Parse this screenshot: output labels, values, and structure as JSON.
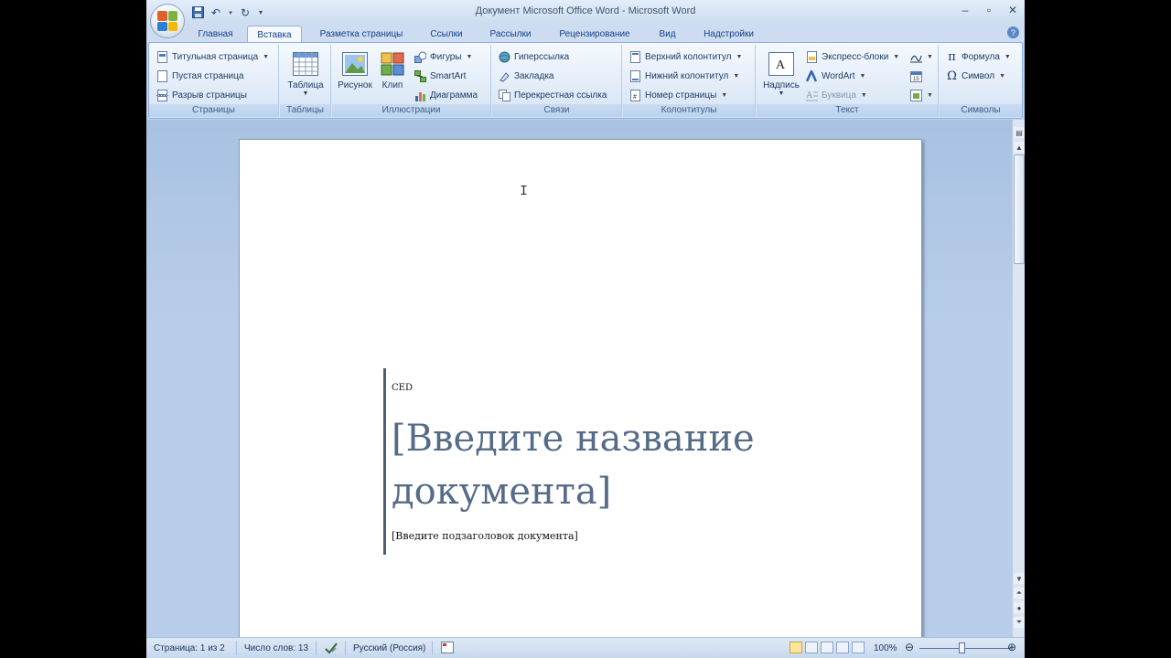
{
  "window": {
    "title": "Документ Microsoft Office Word - Microsoft Word"
  },
  "tabs": [
    {
      "label": "Главная",
      "active": false
    },
    {
      "label": "Вставка",
      "active": true
    },
    {
      "label": "Разметка страницы",
      "active": false
    },
    {
      "label": "Ссылки",
      "active": false
    },
    {
      "label": "Рассылки",
      "active": false
    },
    {
      "label": "Рецензирование",
      "active": false
    },
    {
      "label": "Вид",
      "active": false
    },
    {
      "label": "Надстройки",
      "active": false
    }
  ],
  "ribbon": {
    "pages": {
      "label": "Страницы",
      "items": [
        "Титульная страница",
        "Пустая страница",
        "Разрыв страницы"
      ]
    },
    "tables": {
      "label": "Таблицы",
      "table_button": "Таблица"
    },
    "illustrations": {
      "label": "Иллюстрации",
      "picture": "Рисунок",
      "clip": "Клип",
      "shapes": "Фигуры",
      "smartart": "SmartArt",
      "chart": "Диаграмма"
    },
    "links": {
      "label": "Связи",
      "items": [
        "Гиперссылка",
        "Закладка",
        "Перекрестная ссылка"
      ]
    },
    "header_footer": {
      "label": "Колонтитулы",
      "items": [
        "Верхний колонтитул",
        "Нижний колонтитул",
        "Номер страницы"
      ]
    },
    "text": {
      "label": "Текст",
      "textbox": "Надпись",
      "quick_parts": "Экспресс-блоки",
      "wordart": "WordArt",
      "dropcap": "Буквица"
    },
    "symbols": {
      "label": "Символы",
      "equation": "Формула",
      "symbol": "Символ"
    }
  },
  "document": {
    "company": "CED",
    "title": "[Введите название документа]",
    "subtitle": "[Введите подзаголовок документа]"
  },
  "statusbar": {
    "page": "Страница: 1 из 2",
    "words": "Число слов: 13",
    "language": "Русский (Россия)",
    "zoom": "100%"
  }
}
